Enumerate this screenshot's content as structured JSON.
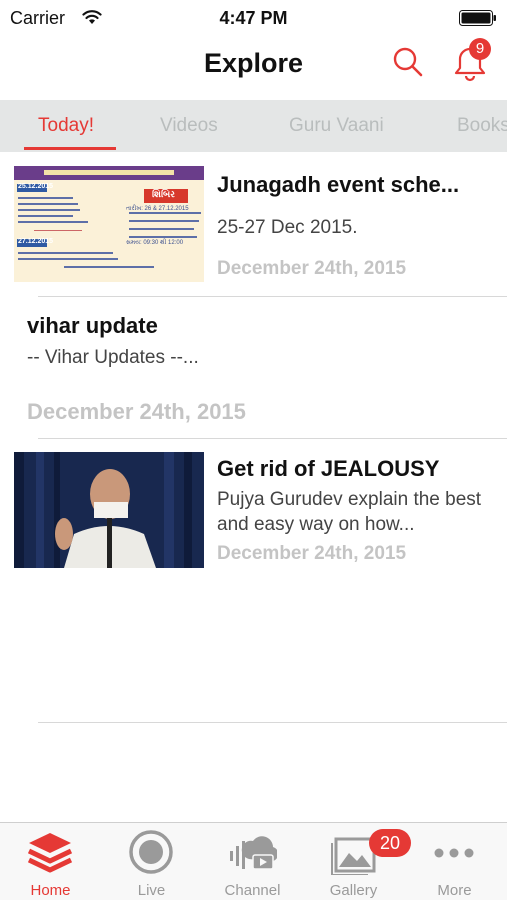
{
  "status_bar": {
    "carrier": "Carrier",
    "time": "4:47 PM"
  },
  "nav": {
    "title": "Explore",
    "notification_count": "9"
  },
  "tabs": [
    {
      "label": "Today!",
      "active": true
    },
    {
      "label": "Videos",
      "active": false
    },
    {
      "label": "Guru Vaani",
      "active": false
    },
    {
      "label": "Books",
      "active": false
    }
  ],
  "feed": [
    {
      "title": "Junagadh event sche...",
      "description": "25-27 Dec 2015.",
      "date": "December 24th, 2015",
      "thumbnail": "event-flyer"
    },
    {
      "title": "vihar update",
      "description": "-- Vihar Updates --...",
      "date": "December 24th, 2015"
    },
    {
      "title": "Get rid of JEALOUSY",
      "description": "Pujya Gurudev explain the best and easy way on how...",
      "date": "December 24th, 2015",
      "thumbnail": "video-frame"
    }
  ],
  "flyer": {
    "date1": "25.12.2015",
    "date2": "27.12.2015",
    "stamp": "શિબિર",
    "dates_text": "તારીખ: 26 & 27.12.2015",
    "time_text": "સમય: 09:30 થી 12:00"
  },
  "tab_bar": [
    {
      "label": "Home",
      "icon": "layers-icon",
      "active": true
    },
    {
      "label": "Live",
      "icon": "live-icon",
      "active": false
    },
    {
      "label": "Channel",
      "icon": "channel-icon",
      "active": false
    },
    {
      "label": "Gallery",
      "icon": "gallery-icon",
      "active": false,
      "badge": "20"
    },
    {
      "label": "More",
      "icon": "more-icon",
      "active": false
    }
  ],
  "colors": {
    "accent": "#e53935",
    "tab_background": "#e4e6e6",
    "date_text": "#c4c4c4"
  }
}
